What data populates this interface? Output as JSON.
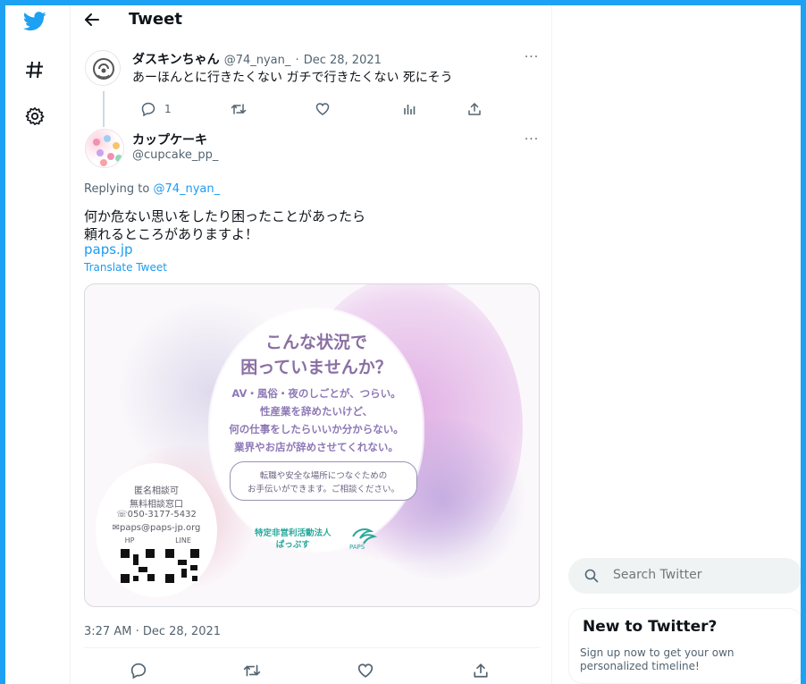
{
  "header": {
    "title": "Tweet"
  },
  "parent_tweet": {
    "name": "ダスキンちゃん",
    "handle": "@74_nyan_",
    "dot": "·",
    "date": "Dec 28, 2021",
    "text": "あーほんとに行きたくない ガチで行きたくない 死にそう",
    "reply_count": "1",
    "more": "···"
  },
  "main_tweet": {
    "name": "カップケーキ",
    "handle": "@cupcake_pp_",
    "replying_prefix": "Replying to ",
    "replying_to": "@74_nyan_",
    "line1": "何か危ない思いをしたり困ったことがあったら",
    "line2": "頼れるところがありますよ！",
    "link": "paps.jp",
    "translate": "Translate Tweet",
    "timestamp": "3:27 AM · Dec 28, 2021",
    "more": "···"
  },
  "poster": {
    "title1": "こんな状況で",
    "title2": "困っていませんか？",
    "line1": "AV・風俗・夜のしごとが、つらい。",
    "line2": "性産業を辞めたいけど、",
    "line3": "何の仕事をしたらいいか分からない。",
    "line4": "業界やお店が辞めさせてくれない。",
    "bubble1": "転職や安全な場所につなぐための",
    "bubble2": "お手伝いができます。ご相談ください。",
    "org1": "特定非営利活動法人",
    "org2": "ぱっぷす",
    "org_logo": "PAPS",
    "left1": "匿名相談可",
    "left2": "無料相談窓口",
    "phone": "☏050-3177-5432",
    "email": "✉paps@paps-jp.org",
    "hp": "HP",
    "line": "LINE"
  },
  "sidebar": {
    "search_placeholder": "Search Twitter",
    "new_title": "New to Twitter?",
    "new_sub": "Sign up now to get your own personalized timeline!"
  },
  "colors": {
    "accent": "#1da1f2",
    "link": "#1d9bf0",
    "muted": "#536471"
  }
}
